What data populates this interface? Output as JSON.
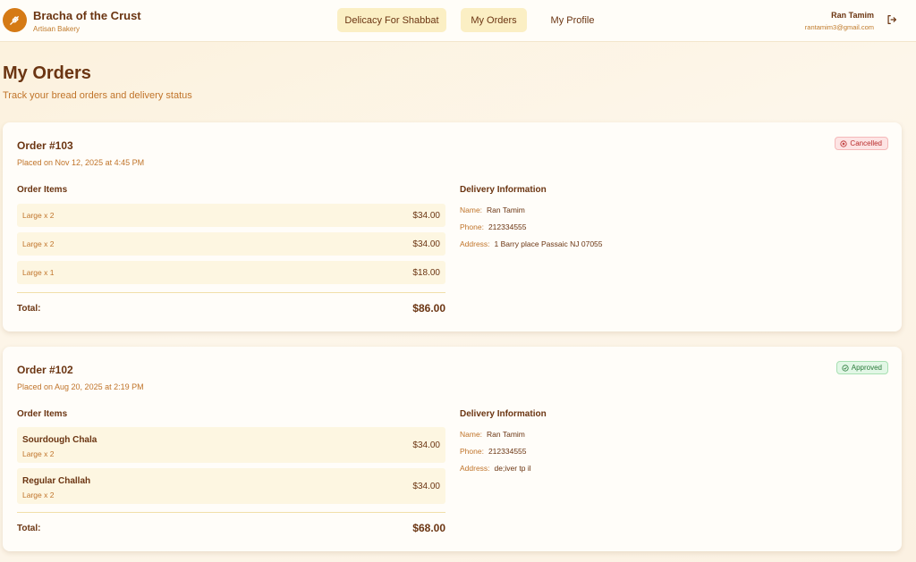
{
  "brand": {
    "name": "Bracha of the Crust",
    "subtitle": "Artisan Bakery"
  },
  "nav": [
    {
      "label": "Delicacy For Shabbat"
    },
    {
      "label": "My Orders"
    },
    {
      "label": "My Profile"
    }
  ],
  "user": {
    "name": "Ran Tamim",
    "email": "rantamim3@gmail.com"
  },
  "page": {
    "title": "My Orders",
    "subtitle": "Track your bread orders and delivery status"
  },
  "labels": {
    "order_items": "Order Items",
    "delivery_info": "Delivery Information",
    "total": "Total:",
    "name": "Name:",
    "phone": "Phone:",
    "address": "Address:"
  },
  "orders": [
    {
      "title": "Order #103",
      "placed": "Placed on Nov 12, 2025 at 4:45 PM",
      "status": "Cancelled",
      "items": [
        {
          "name": "",
          "qty": "Large x 2",
          "price": "$34.00"
        },
        {
          "name": "",
          "qty": "Large x 2",
          "price": "$34.00"
        },
        {
          "name": "",
          "qty": "Large x 1",
          "price": "$18.00"
        }
      ],
      "total": "$86.00",
      "delivery": {
        "name": "Ran Tamim",
        "phone": "212334555",
        "address": "1 Barry place Passaic NJ 07055"
      }
    },
    {
      "title": "Order #102",
      "placed": "Placed on Aug 20, 2025 at 2:19 PM",
      "status": "Approved",
      "items": [
        {
          "name": "Sourdough Chala",
          "qty": "Large x 2",
          "price": "$34.00"
        },
        {
          "name": "Regular Challah",
          "qty": "Large x 2",
          "price": "$34.00"
        }
      ],
      "total": "$68.00",
      "delivery": {
        "name": "Ran Tamim",
        "phone": "212334555",
        "address": "de;iver tp il"
      }
    }
  ],
  "colors": {
    "accent": "#d57a15",
    "text": "#6b3512",
    "muted": "#c0742a",
    "nav_active": "#fbefc4"
  },
  "icons": {
    "logo": "wheat-icon",
    "logout": "logout-icon",
    "cancelled": "x-circle-icon",
    "approved": "check-circle-icon"
  }
}
